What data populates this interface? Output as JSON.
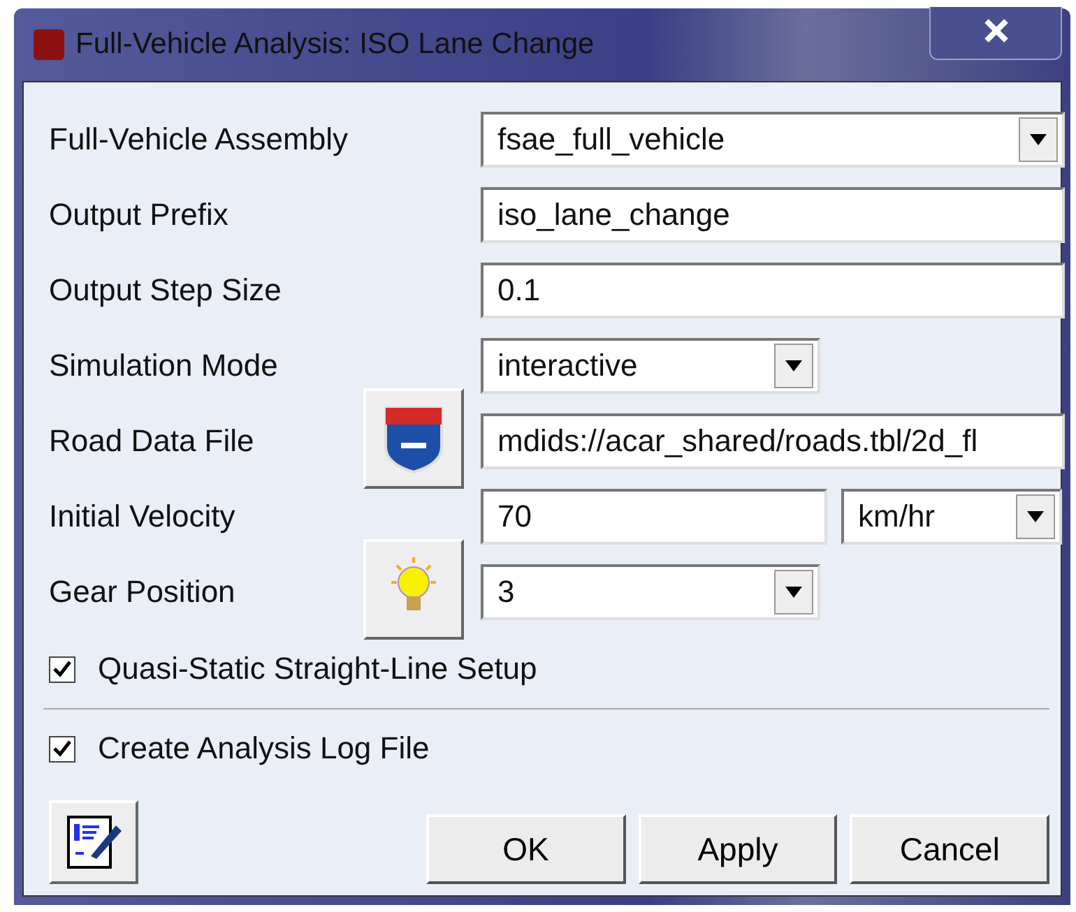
{
  "window": {
    "title": "Full-Vehicle Analysis: ISO Lane Change"
  },
  "fields": [
    {
      "label": "Full-Vehicle Assembly",
      "kind": "combo",
      "value": "fsae_full_vehicle"
    },
    {
      "label": "Output Prefix",
      "kind": "text",
      "value": "iso_lane_change"
    },
    {
      "label": "Output Step Size",
      "kind": "text",
      "value": "0.1"
    },
    {
      "label": "Simulation Mode",
      "kind": "choice",
      "value": "interactive"
    },
    {
      "label": "Road Data File",
      "kind": "file",
      "value": "mdids://acar_shared/roads.tbl/2d_fl"
    },
    {
      "label": "Initial Velocity",
      "kind": "quantity",
      "value": "70",
      "unit": "km/hr"
    },
    {
      "label": "Gear Position",
      "kind": "hinted",
      "value": "3"
    }
  ],
  "options": [
    {
      "label": "Quasi-Static Straight-Line Setup",
      "checked": true
    },
    {
      "label": "Create Analysis Log File",
      "checked": true
    }
  ],
  "buttons": [
    "OK",
    "Apply",
    "Cancel"
  ]
}
